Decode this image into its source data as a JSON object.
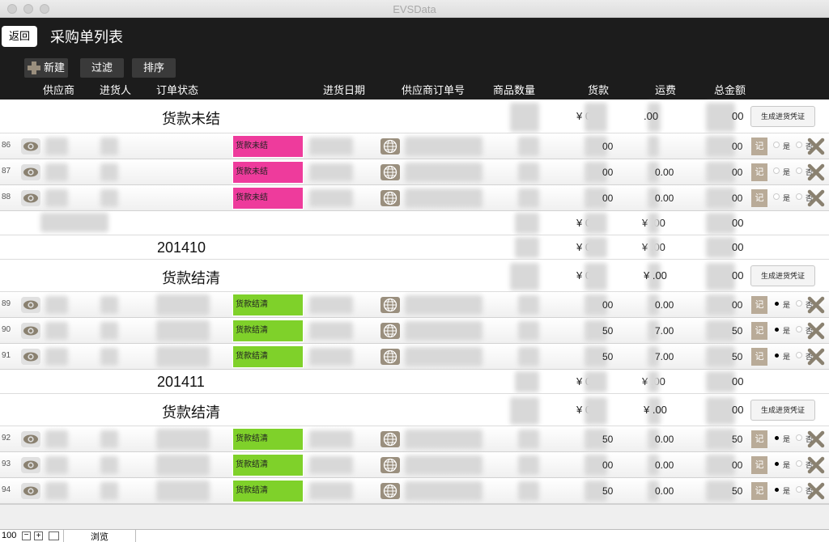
{
  "window": {
    "title": "EVSData"
  },
  "header": {
    "back": "返回",
    "title": "采购单列表",
    "new_label": "新建",
    "filter_label": "过滤",
    "sort_label": "排序"
  },
  "columns": {
    "supplier": "供应商",
    "purchaser": "进货人",
    "order_status": "订单状态",
    "purchase_date": "进货日期",
    "supplier_order_no": "供应商订单号",
    "qty": "商品数量",
    "goods_amount": "货款",
    "freight": "运费",
    "total": "总金额"
  },
  "groups": [
    {
      "label": "货款未结",
      "goods_amount": "¥    00",
      "freight": ".00",
      "total": "00",
      "voucher": "生成进货凭证",
      "rows": [
        {
          "no": "86",
          "status": "货款未结",
          "goods": "00",
          "freight": "",
          "total": "00"
        },
        {
          "no": "87",
          "status": "货款未结",
          "goods": "00",
          "freight": "0.00",
          "total": "00"
        },
        {
          "no": "88",
          "status": "货款未结",
          "goods": "00",
          "freight": "0.00",
          "total": "00"
        }
      ]
    },
    {
      "label": "货款结清",
      "goods_amount": "¥    00",
      "freight": "¥    .00",
      "total": "00",
      "voucher": "生成进货凭证",
      "rows": [
        {
          "no": "89",
          "status": "货款结清",
          "goods": "00",
          "freight": "0.00",
          "total": "00"
        },
        {
          "no": "90",
          "status": "货款结清",
          "goods": "50",
          "freight": "7.00",
          "total": "50"
        },
        {
          "no": "91",
          "status": "货款结清",
          "goods": "50",
          "freight": "7.00",
          "total": "50"
        }
      ]
    },
    {
      "label": "货款结清",
      "goods_amount": "¥    00",
      "freight": "¥    .00",
      "total": "00",
      "voucher": "生成进货凭证",
      "rows": [
        {
          "no": "92",
          "status": "货款结清",
          "goods": "50",
          "freight": "0.00",
          "total": "50"
        },
        {
          "no": "93",
          "status": "货款结清",
          "goods": "00",
          "freight": "0.00",
          "total": "00"
        },
        {
          "no": "94",
          "status": "货款结清",
          "goods": "50",
          "freight": "0.00",
          "total": "50"
        }
      ]
    }
  ],
  "subtotal": {
    "goods": "¥    00",
    "freight": "¥    .00",
    "total": "00"
  },
  "month1": {
    "label": "201410",
    "goods": "¥    00",
    "freight": "¥    .00",
    "total": "00"
  },
  "month2": {
    "label": "201411",
    "goods": "¥    00",
    "freight": "¥    .00",
    "total": "00"
  },
  "row_actions": {
    "ji": "记",
    "yes": "是",
    "no": "否"
  },
  "statusbar": {
    "zoom": "100",
    "mode": "浏览"
  },
  "colors": {
    "unpaid": "#ee3b9c",
    "paid": "#7fd12a",
    "accent": "#b9ab98"
  }
}
